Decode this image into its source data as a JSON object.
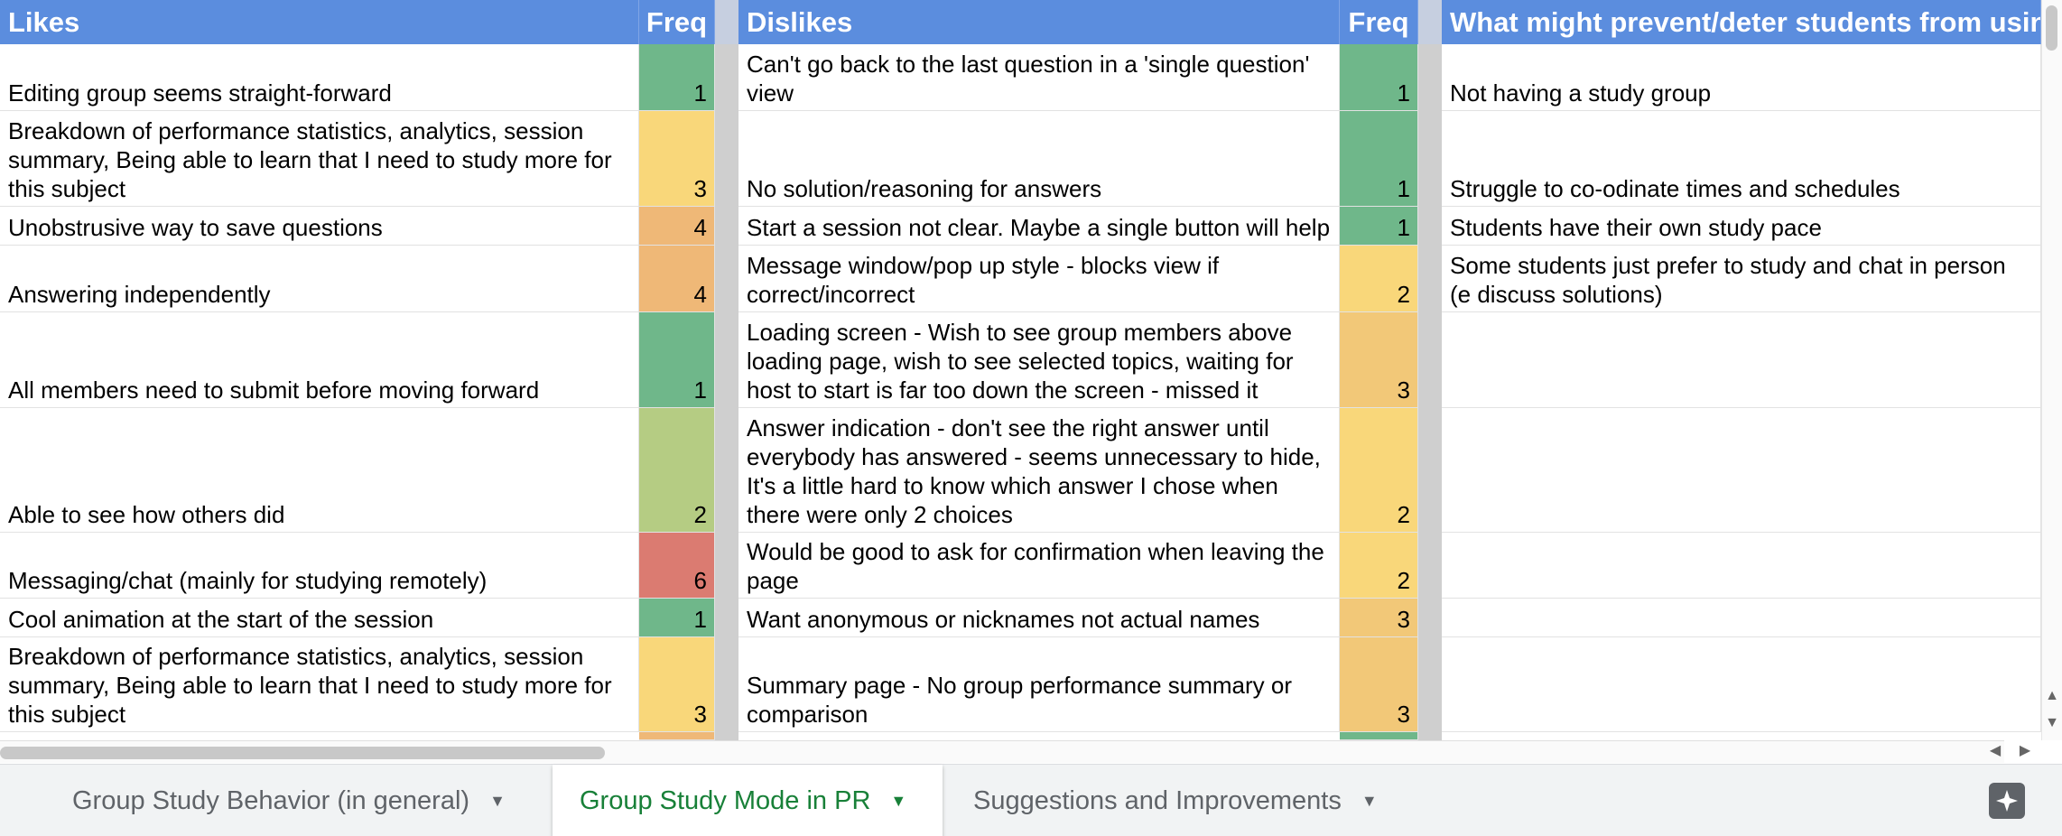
{
  "columns": {
    "likes": "Likes",
    "likes_freq": "Freq",
    "dislikes": "Dislikes",
    "dislikes_freq": "Freq",
    "prevent": "What might prevent/deter students from usin"
  },
  "rows": [
    {
      "like": "Editing group seems straight-forward",
      "lf": "1",
      "lc": "#6fb78a",
      "dis": "Can't go back to the last question in a 'single question' view",
      "df": "1",
      "dc": "#6fb78a",
      "prevent": "Not having a study group"
    },
    {
      "like": "Breakdown of performance statistics, analytics, session summary, Being able to learn that I need to study more for this subject",
      "lf": "3",
      "lc": "#f9d77a",
      "dis": "No solution/reasoning for answers",
      "df": "1",
      "dc": "#6fb78a",
      "prevent": "Struggle to co-odinate times and schedules"
    },
    {
      "like": "Unobstrusive way to save questions",
      "lf": "4",
      "lc": "#efb877",
      "dis": "Start a session not clear. Maybe a single button will help",
      "df": "1",
      "dc": "#6fb78a",
      "prevent": "Students have their own study pace"
    },
    {
      "like": "Answering independently",
      "lf": "4",
      "lc": "#efb877",
      "dis": "Message window/pop up style - blocks view if correct/incorrect",
      "df": "2",
      "dc": "#f9d77a",
      "prevent": "Some students just prefer to study and chat in person (e discuss solutions)"
    },
    {
      "like": "All members need to submit before moving forward",
      "lf": "1",
      "lc": "#6fb78a",
      "dis": "Loading screen - Wish to see group members above loading page, wish to see selected topics, waiting for host to start is far too down the screen - missed it",
      "df": "3",
      "dc": "#f2c878",
      "prevent": ""
    },
    {
      "like": "Able to see how others did",
      "lf": "2",
      "lc": "#b5cc83",
      "dis": "Answer indication - don't see the right answer until everybody has answered - seems unnecessary to hide, It's a little hard to know which answer I chose when there were only 2 choices",
      "df": "2",
      "dc": "#f9d77a",
      "prevent": ""
    },
    {
      "like": "Messaging/chat (mainly for studying remotely)",
      "lf": "6",
      "lc": "#db7b71",
      "dis": "Would be good to ask for confirmation when leaving the page",
      "df": "2",
      "dc": "#f9d77a",
      "prevent": ""
    },
    {
      "like": "Cool animation at the start of the session",
      "lf": "1",
      "lc": "#6fb78a",
      "dis": "Want anonymous or nicknames not actual names",
      "df": "3",
      "dc": "#f2c878",
      "prevent": ""
    },
    {
      "like": "Breakdown of performance statistics, analytics, session summary, Being able to learn that I need to study more for this subject",
      "lf": "3",
      "lc": "#f9d77a",
      "dis": "Summary page - No group performance summary or comparison",
      "df": "3",
      "dc": "#f2c878",
      "prevent": ""
    }
  ],
  "tabs": [
    {
      "label": "Group Study Behavior (in general)",
      "active": false
    },
    {
      "label": "Group Study Mode in PR",
      "active": true
    },
    {
      "label": "Suggestions and Improvements",
      "active": false
    }
  ],
  "icons": {
    "tab_caret": "caret-down-icon",
    "explore": "explore-icon",
    "scroll_left": "scroll-left-icon",
    "scroll_right": "scroll-right-icon",
    "scroll_up": "scroll-up-icon",
    "scroll_down": "scroll-down-icon"
  },
  "colors": {
    "header_bg": "#5b8dde",
    "active_tab": "#188038",
    "freq_1": "#6fb78a",
    "freq_2": "#b5cc83",
    "freq_3": "#f9d77a",
    "freq_4": "#efb877",
    "freq_6": "#db7b71"
  }
}
